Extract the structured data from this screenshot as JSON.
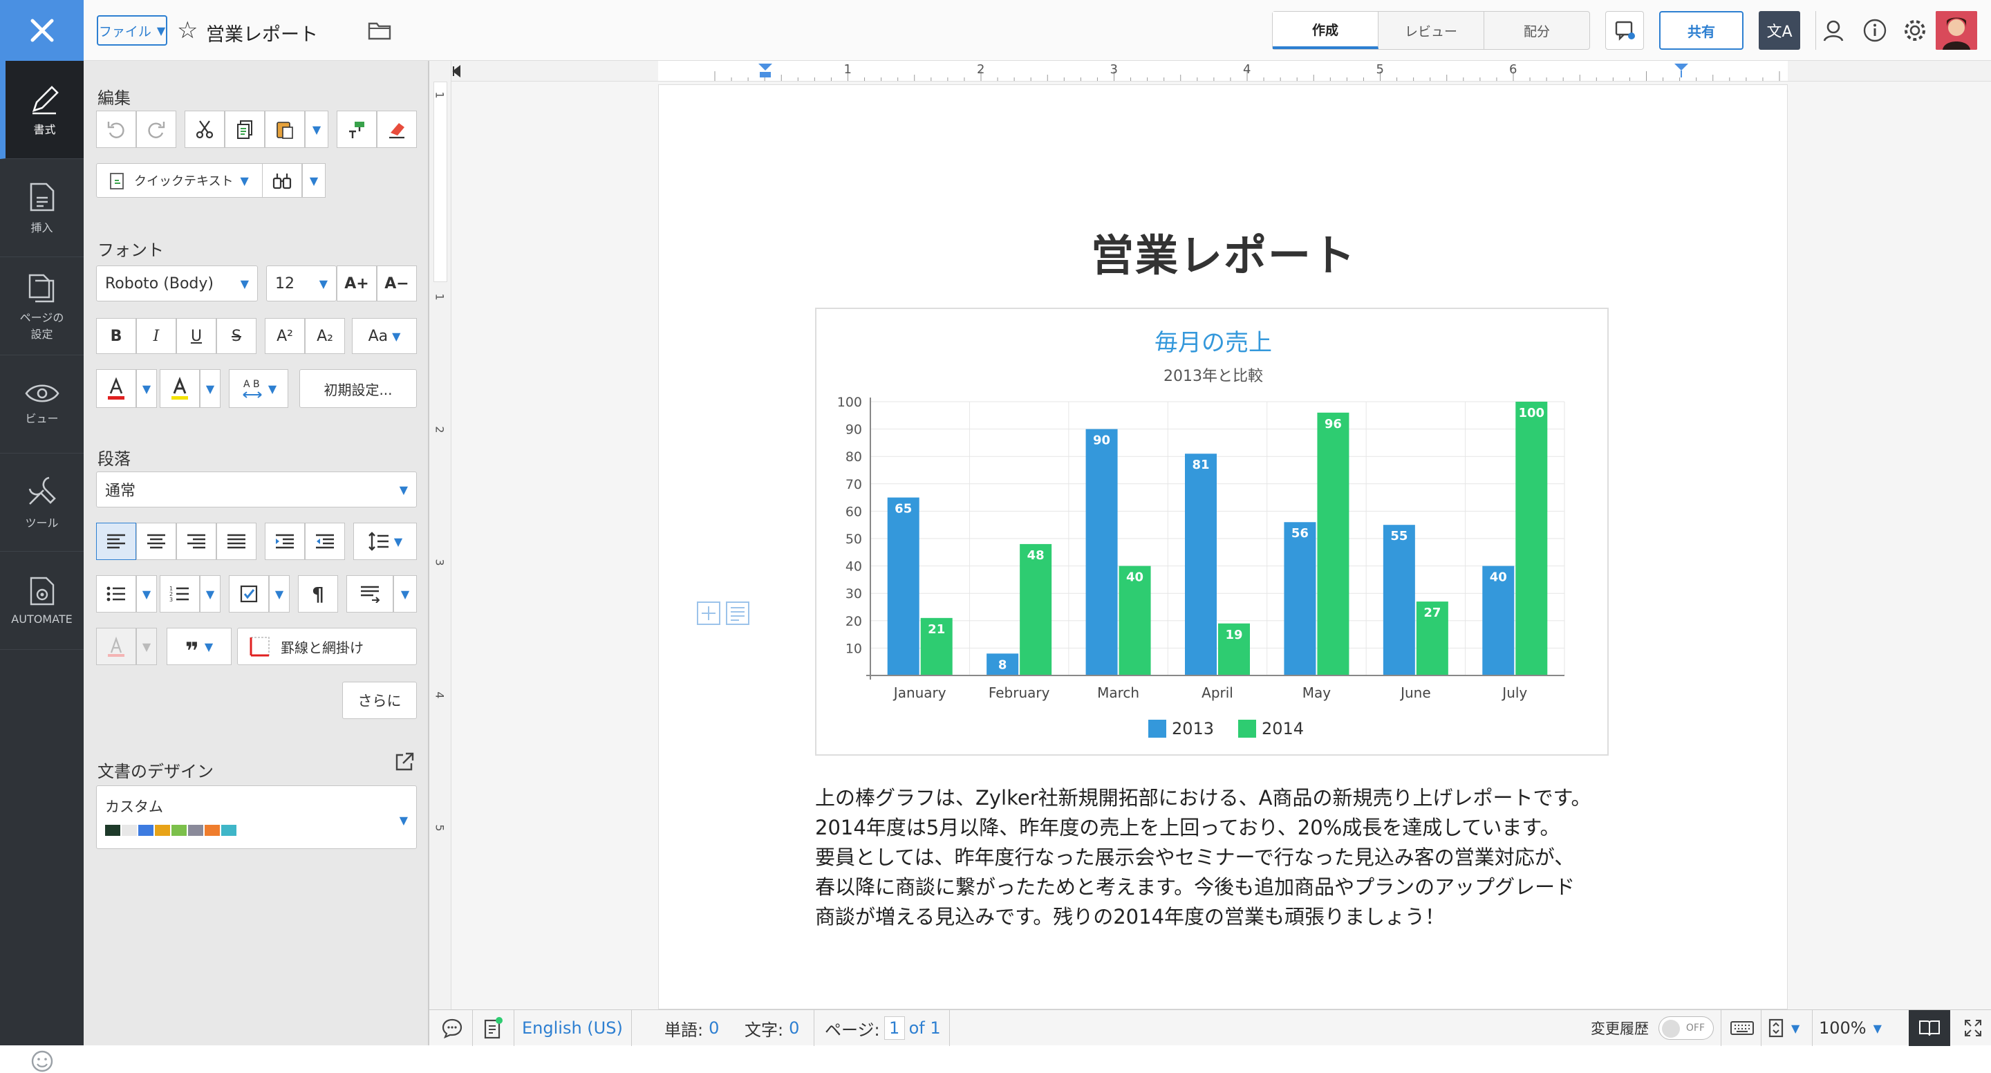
{
  "topbar": {
    "file_label": "ファイル",
    "doc_title": "営業レポート",
    "tabs": [
      "作成",
      "レビュー",
      "配分"
    ],
    "share_label": "共有",
    "lang_tool_label": "文A"
  },
  "rail": [
    {
      "label": "書式",
      "icon": "format-brush-icon"
    },
    {
      "label": "挿入",
      "icon": "insert-doc-icon"
    },
    {
      "label": "ページの設定",
      "icon": "page-setup-icon"
    },
    {
      "label": "ビュー",
      "icon": "eye-icon"
    },
    {
      "label": "ツール",
      "icon": "tools-icon"
    },
    {
      "label": "AUTOMATE",
      "icon": "automate-icon"
    }
  ],
  "panel": {
    "edit_title": "編集",
    "quicktext_label": "クイックテキスト",
    "font_title": "フォント",
    "font_family": "Roboto  (Body)",
    "font_size": "12",
    "font_sizeup": "A+",
    "font_sizedown": "A−",
    "bold": "B",
    "italic": "I",
    "underline": "U",
    "strike": "S",
    "superscript": "A²",
    "subscript": "A₂",
    "change_case": "Aa",
    "default_settings": "初期設定...",
    "paragraph_title": "段落",
    "paragraph_style": "通常",
    "borders_label": "罫線と網掛け",
    "more_label": "さらに",
    "design_title": "文書のデザイン",
    "design_value": "カスタム",
    "design_swatches": [
      "#1e3a2a",
      "#e8e8e8",
      "#3d7be0",
      "#e8a317",
      "#7cc04b",
      "#8a8a9a",
      "#ef7d2d",
      "#3fb6c8"
    ]
  },
  "document": {
    "title": "営業レポート",
    "paragraph": [
      "上の棒グラフは、Zylker社新規開拓部における、A商品の新規売り上げレポートです。",
      "2014年度は5月以降、昨年度の売上を上回っており、20%成長を達成しています。",
      "要員としては、昨年度行なった展示会やセミナーで行なった見込み客の営業対応が、",
      "春以降に商談に繋がったためと考えます。今後も追加商品やプランのアップグレード",
      "商談が増える見込みです。残りの2014年度の営業も頑張りましょう！"
    ]
  },
  "chart_data": {
    "type": "bar",
    "title": "毎月の売上",
    "subtitle": "2013年と比較",
    "categories": [
      "January",
      "February",
      "March",
      "April",
      "May",
      "June",
      "July"
    ],
    "series": [
      {
        "name": "2013",
        "color": "#3498db",
        "values": [
          65,
          8,
          90,
          81,
          56,
          55,
          40
        ]
      },
      {
        "name": "2014",
        "color": "#2ecc71",
        "values": [
          21,
          48,
          40,
          19,
          96,
          27,
          100
        ]
      }
    ],
    "ylim": [
      0,
      100
    ],
    "yticks": [
      10,
      20,
      30,
      40,
      50,
      60,
      70,
      80,
      90,
      100
    ],
    "grid": true,
    "legend": "bottom-center"
  },
  "ruler": {
    "h_labels": [
      "1",
      "2",
      "3",
      "4",
      "5",
      "6"
    ],
    "v_labels": [
      "1",
      "1",
      "2",
      "3",
      "4",
      "5"
    ]
  },
  "status": {
    "language": "English (US)",
    "words_label": "単語:",
    "words_value": "0",
    "chars_label": "文字:",
    "chars_value": "0",
    "page_label": "ページ:",
    "page_value": "1",
    "page_of": "of 1",
    "track_label": "変更履歴",
    "track_state": "OFF",
    "zoom": "100%"
  }
}
